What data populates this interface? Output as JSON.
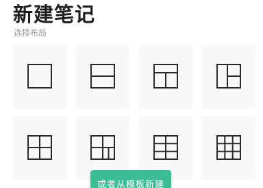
{
  "header": {
    "title": "新建笔记",
    "subtitle": "选择布局"
  },
  "layouts": [
    {
      "name": "single",
      "icon": "layout-single-icon"
    },
    {
      "name": "two-rows",
      "icon": "layout-two-rows-icon"
    },
    {
      "name": "top-wide-bottom-split",
      "icon": "layout-top-wide-bottom-split-icon"
    },
    {
      "name": "left-tall-right-split",
      "icon": "layout-left-tall-right-split-icon"
    },
    {
      "name": "grid-2x2",
      "icon": "layout-grid-2x2-icon"
    },
    {
      "name": "grid-2x2-plus-split",
      "icon": "layout-grid-2x2-plus-split-icon"
    },
    {
      "name": "grid-3x2",
      "icon": "layout-grid-3x2-icon"
    },
    {
      "name": "grid-3x3",
      "icon": "layout-grid-3x3-icon"
    }
  ],
  "cta": {
    "label": "或者从模板新建"
  },
  "colors": {
    "accent": "#3dbd96",
    "tile_background": "#f8f8f8",
    "icon_stroke": "#2a2a2a",
    "title_text": "#1f1f1f",
    "subtitle_text": "#9a9a9a"
  }
}
